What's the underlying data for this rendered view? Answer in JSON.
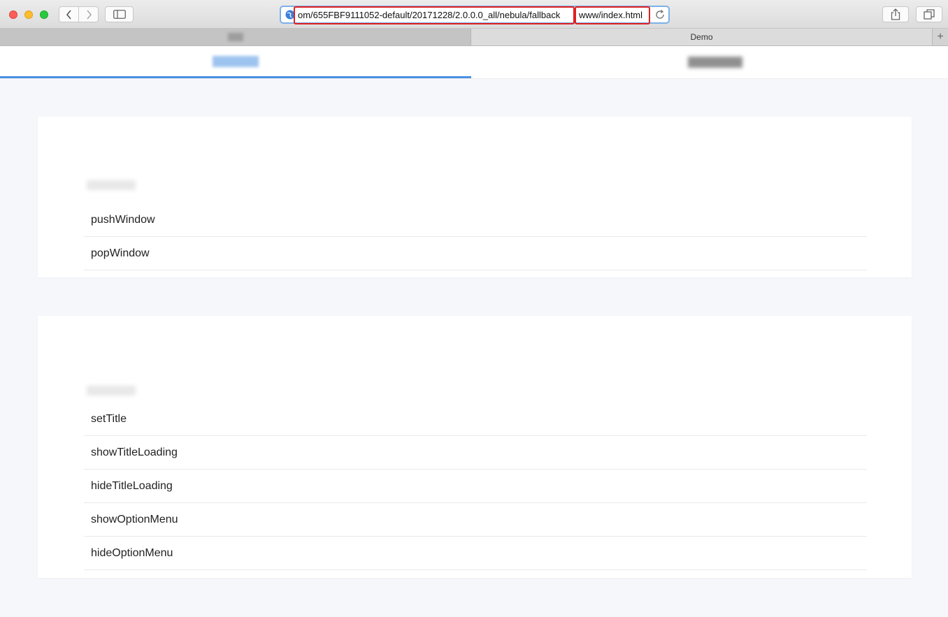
{
  "browser": {
    "url_prefix": "om/655FBF9111052-default/20171228/2.0.0.0_all/nebula/fallback",
    "url_suffix": "www/index.html",
    "tabs": [
      {
        "label": ""
      },
      {
        "label": "Demo"
      }
    ],
    "new_tab_label": "+"
  },
  "page": {
    "tabs": [
      {
        "label": ""
      },
      {
        "label": ""
      }
    ],
    "sections": [
      {
        "title": "",
        "items": [
          "pushWindow",
          "popWindow"
        ]
      },
      {
        "title": "",
        "items": [
          "setTitle",
          "showTitleLoading",
          "hideTitleLoading",
          "showOptionMenu",
          "hideOptionMenu"
        ]
      }
    ]
  },
  "colors": {
    "accent": "#4a90e2",
    "highlight_box": "#e02020",
    "page_background": "#f6f7fb"
  },
  "icons": [
    "back-icon",
    "forward-icon",
    "sidebar-icon",
    "globe-icon",
    "reload-icon",
    "share-icon",
    "tabs-overview-icon"
  ]
}
